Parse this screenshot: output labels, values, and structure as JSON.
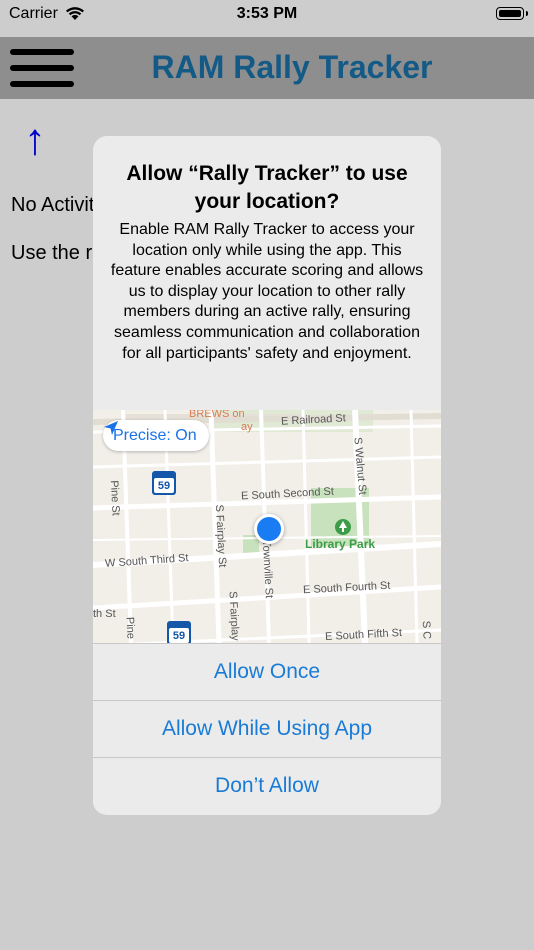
{
  "status_bar": {
    "carrier": "Carrier",
    "time": "3:53 PM"
  },
  "nav": {
    "title": "RAM Rally Tracker"
  },
  "main": {
    "arrow": "↑",
    "no_activity": "No Activit",
    "instructions": "Use the r                                                 ctice your skills"
  },
  "alert": {
    "title": "Allow “Rally Tracker” to use your location?",
    "message": "Enable RAM Rally Tracker to access your location only while using the app. This feature enables accurate scoring and allows us to display your location to other rally members during an active rally, ensuring seamless communication and collaboration for all participants' safety and enjoyment.",
    "precise": "Precise: On",
    "map": {
      "poi": "BREWS on",
      "poi2": "ay",
      "streets": {
        "railroad": "E Railroad St",
        "walnut": "S Walnut St",
        "pine": "Pine St",
        "second": "E South Second St",
        "fairplay": "S Fairplay St",
        "fairplay2": "S Fairplay",
        "third": "W South Third St",
        "townville": "S Townville St",
        "fourth": "E South Fourth St",
        "fifth": "E South Fifth St",
        "pine2": "Pine",
        "th_st": "th St",
        "s_edge": "S C"
      },
      "park": "Library Park",
      "route": "59"
    },
    "buttons": {
      "allow_once": "Allow Once",
      "allow_while_using": "Allow While Using App",
      "dont_allow": "Don’t Allow"
    }
  },
  "colors": {
    "accent": "#1a7bd6",
    "title": "#145a86",
    "nav_bg": "#8e8e8e"
  }
}
